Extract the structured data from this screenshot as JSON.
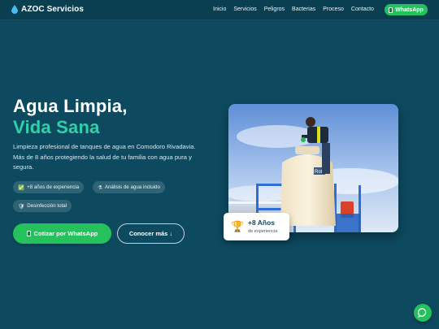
{
  "nav": {
    "brand": "AZOC Servicios",
    "brand_icon": "water-drop-icon",
    "links": [
      "Inicio",
      "Servicios",
      "Peligros",
      "Bacterias",
      "Proceso",
      "Contacto"
    ],
    "whatsapp_label": "WhatsApp"
  },
  "hero": {
    "title_line1": "Agua Limpia,",
    "title_line2": "Vida Sana",
    "description": "Limpieza profesional de tanques de agua en Comodoro Rivadavia. Más de 8 años protegiendo la salud de tu familia con agua pura y segura.",
    "chips": [
      {
        "icon": "check-icon",
        "label": "+8 años de experiencia"
      },
      {
        "icon": "flask-icon",
        "label": "Análisis de agua incluido"
      },
      {
        "icon": "shield-icon",
        "label": "Desinfección total"
      }
    ],
    "cta_primary": "Cotizar por WhatsApp",
    "cta_secondary": "Conocer más ↓"
  },
  "badge": {
    "number": "+8 Años",
    "subtitle": "de experiencia",
    "icon": "trophy-icon"
  },
  "colors": {
    "background": "#0d4a60",
    "accent": "#2ed1aa",
    "whatsapp": "#25c15d"
  }
}
